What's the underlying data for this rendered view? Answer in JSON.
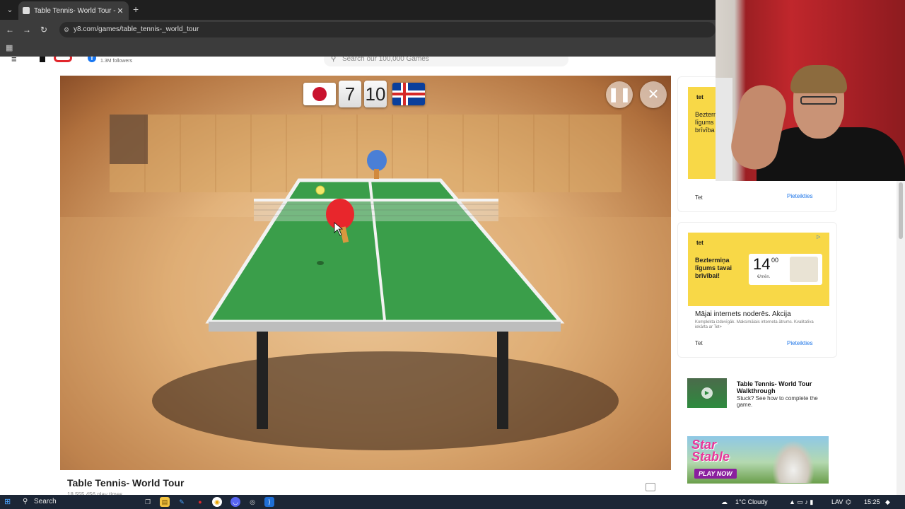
{
  "browser": {
    "tab_title": "Table Tennis- World Tour - Play",
    "url": "y8.com/games/table_tennis-_world_tour"
  },
  "site": {
    "followers": "1.3M followers",
    "search_placeholder": "Search our 100,000 Games"
  },
  "game": {
    "score_left": "7",
    "score_right": "10",
    "left_flag": "japan-flag",
    "right_flag": "iceland-flag",
    "title": "Table Tennis- World Tour",
    "play_times": "18,555,456 play times"
  },
  "ads": {
    "ad1": {
      "brand": "tet",
      "headline": "Bezterm\nlīgums\nbrīvība",
      "footer": "Tet",
      "link": "Pieteikties"
    },
    "ad2": {
      "brand": "tet",
      "headline": "Beztermiņa\nlīgums tavai\nbrīvībai!",
      "price": "14",
      "price_cents": "00",
      "price_unit": "€/mēn.",
      "title": "Mājai internets noderēs. Akcija",
      "desc": "Komplekta izdevīgāk. Maksimālais interneta ātrums. Kvalitatīva iekārta ar Tet+",
      "footer": "Tet",
      "link": "Pieteikties"
    }
  },
  "walkthrough": {
    "title": "Table Tennis- World Tour Walkthrough",
    "desc": "Stuck? See how to complete the game."
  },
  "star_ad": {
    "logo": "Star Stable",
    "button": "PLAY NOW"
  },
  "taskbar": {
    "search": "Search",
    "weather": "1°C Cloudy",
    "lang": "LAV",
    "time": "15:25"
  },
  "colors": {
    "table_green": "#3a9e4a",
    "paddle_red": "#e8262c",
    "paddle_blue": "#4a7fd6"
  }
}
